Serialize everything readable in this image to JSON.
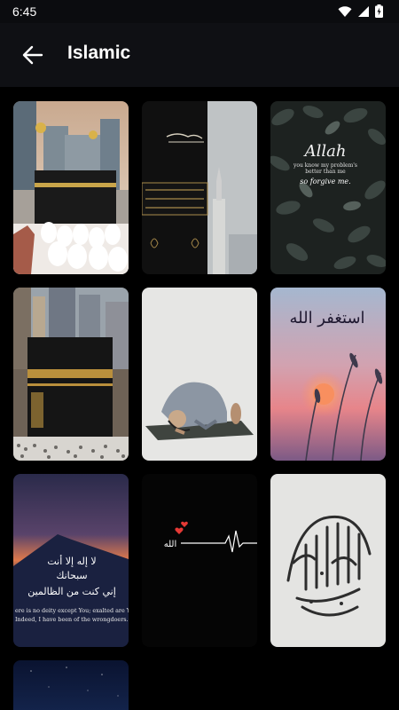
{
  "status_bar": {
    "time": "6:45",
    "icons": [
      "wifi-icon",
      "signal-icon",
      "battery-icon"
    ]
  },
  "app_bar": {
    "title": "Islamic",
    "back_icon": "arrow-left-icon"
  },
  "wallpapers": [
    {
      "name": "kaaba-tower-wallpaper",
      "texts": []
    },
    {
      "name": "kaaba-door-wallpaper",
      "texts": []
    },
    {
      "name": "allah-leaves-wallpaper",
      "texts": [
        "Allah",
        "you know my problem's",
        "better than me",
        "so forgive me."
      ]
    },
    {
      "name": "kaaba-crowd-wallpaper",
      "texts": []
    },
    {
      "name": "sujood-prayer-wallpaper",
      "texts": []
    },
    {
      "name": "astaghfirullah-sunset-wallpaper",
      "texts": [
        "استغفر الله"
      ]
    },
    {
      "name": "mountain-dua-wallpaper",
      "texts": [
        "لا إله إلا أنت",
        "سبحانك",
        "إني كنت من الظالمين",
        "ere is no deity except You; exalted are Y",
        "Indeed, I have been of the wrongdoers."
      ]
    },
    {
      "name": "heartbeat-allah-wallpaper",
      "texts": [
        "الله"
      ]
    },
    {
      "name": "shahada-calligraphy-wallpaper",
      "texts": []
    },
    {
      "name": "night-wallpaper-partial",
      "texts": []
    }
  ],
  "colors": {
    "app_bar_bg": "#0f1014",
    "background": "#000000",
    "text": "#ffffff"
  }
}
